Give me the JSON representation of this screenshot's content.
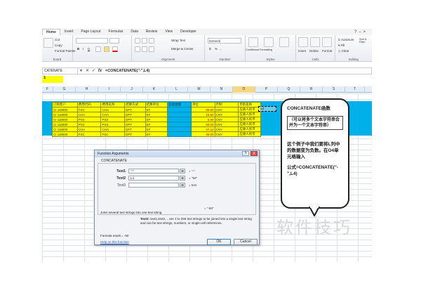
{
  "ribbon": {
    "tabs": [
      "Home",
      "Insert",
      "Page Layout",
      "Formulas",
      "Data",
      "Review",
      "View",
      "Developer"
    ],
    "clipboard": {
      "cut": "Cut",
      "copy": "Copy",
      "format_painter": "Format Painter",
      "label": "board"
    },
    "alignment": {
      "wrap_text": "Wrap Text",
      "merge_center": "Merge & Center",
      "label": "Alignment"
    },
    "number": {
      "format": "General",
      "label": "Number"
    },
    "styles": {
      "conditional": "Conditional Formatting",
      "format_table": "Format as Table",
      "cell_styles": "Cell Styles",
      "label": "Styles"
    },
    "cells": {
      "insert": "Insert",
      "delete": "Delete",
      "format": "Format",
      "label": "Cells"
    },
    "editing": {
      "autosum": "AutoSum",
      "fill": "Fill",
      "clear": "Clear",
      "sort": "Sort & Filter",
      "label": "Editing"
    }
  },
  "formula_bar": {
    "name_box": "CATENATE",
    "formula": "=CONCATENATE(\"-\",L4)"
  },
  "sheet": {
    "top_cell": "1",
    "columns": [
      "F",
      "G",
      "H",
      "I",
      "J",
      "K",
      "L",
      "M",
      "N",
      "O",
      "P",
      "Q",
      "R",
      "S",
      "T"
    ],
    "selected_column": "O",
    "header_row": [
      "订购客户",
      "费用代码",
      "费用名称",
      "结算方式",
      "结算单位",
      "应收金额",
      "单位",
      "币制",
      "币别名称"
    ],
    "rows": [
      [
        "CI 118000",
        "FSC",
        "CHA",
        "DPT",
        "EF",
        "",
        "95.00",
        "CNY",
        "应收人民币"
      ],
      [
        "CI 118000",
        "CHA",
        "CHA",
        "DPT",
        "EF",
        "",
        "15.50",
        "CNY",
        "应收人民币"
      ],
      [
        "CI 118000",
        "PSS",
        "PSS",
        "DPT",
        "EF",
        "",
        "5.00",
        "CNY",
        "应收人民币"
      ],
      [
        "CI 118000",
        "PSS",
        "PSS",
        "DPT",
        "EF",
        "",
        "55.00",
        "CNY",
        "应收人民币"
      ],
      [
        "CI 118000",
        "CHA",
        "CHA",
        "DPT",
        "EF",
        "",
        "27.14",
        "CNY",
        "应收人民币"
      ],
      [
        "CI 118000",
        "FSC",
        "FSC",
        "DPT",
        "EF",
        "",
        "46.00",
        "CNY",
        "应收人民币"
      ]
    ],
    "o4_value": "-L4"
  },
  "dialog": {
    "title": "Function Arguments",
    "help_btn": "?",
    "close_btn": "X",
    "function_name": "CONCATENATE",
    "args": [
      {
        "label": "Text1",
        "value": "\"-\"",
        "result": "= \"-\""
      },
      {
        "label": "Text2",
        "value": "L4",
        "result": "= \"50\""
      },
      {
        "label": "Text3",
        "value": "",
        "result": "= text"
      }
    ],
    "result_preview": "= \"-50\"",
    "description": "Joins several text strings into one text string.",
    "arg_desc_label": "Text2:",
    "arg_desc_text": "text1,text2,... are 1 to 255 text strings to be joined into a single text string and can be text strings, numbers, or single-cell references.",
    "formula_result": "Formula result =  -50",
    "help_link": "Help on this function",
    "ok": "OK",
    "cancel": "Cancel"
  },
  "callout": {
    "title": "CONCATENATE函数",
    "box": "（可以将多个文本字符串合并为一个文本字符串）",
    "p1": "这个例子中我们要将L列中的数据变为负数。在O4单元格输入",
    "p2": "公式=CONCATENATE(\"-\",L4)"
  },
  "watermark": "软件技巧",
  "colors": {
    "cyan": "#00b0e8",
    "yellow": "#ffff00",
    "link": "#1a55c4"
  }
}
